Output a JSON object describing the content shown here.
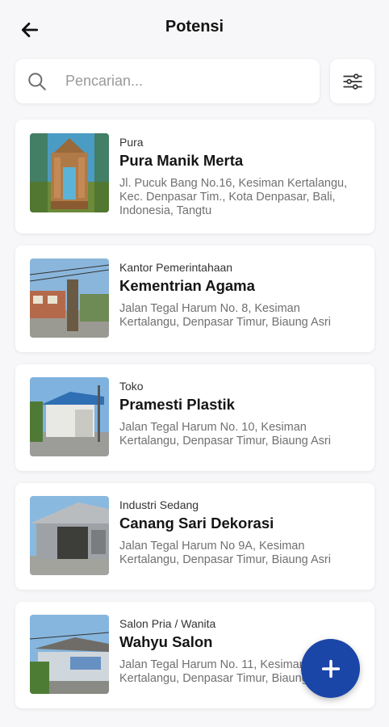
{
  "header": {
    "title": "Potensi",
    "back_icon": "arrow-left-icon"
  },
  "search": {
    "placeholder": "Pencarian...",
    "value": "",
    "icon": "search-icon"
  },
  "filter": {
    "icon": "sliders-icon"
  },
  "items": [
    {
      "category": "Pura",
      "name": "Pura Manik Merta",
      "address": "Jl. Pucuk Bang No.16, Kesiman Kertalangu, Kec. Denpasar Tim., Kota Denpasar, Bali, Indonesia, Tangtu"
    },
    {
      "category": "Kantor Pemerintahaan",
      "name": "Kementrian Agama",
      "address": "Jalan Tegal Harum No. 8, Kesiman Kertalangu, Denpasar Timur, Biaung Asri"
    },
    {
      "category": "Toko",
      "name": "Pramesti Plastik",
      "address": "Jalan Tegal Harum No. 10, Kesiman Kertalangu, Denpasar Timur, Biaung Asri"
    },
    {
      "category": "Industri Sedang",
      "name": "Canang Sari Dekorasi",
      "address": "Jalan Tegal Harum No 9A, Kesiman Kertalangu, Denpasar Timur, Biaung Asri"
    },
    {
      "category": "Salon Pria / Wanita",
      "name": "Wahyu Salon",
      "address": "Jalan Tegal Harum No. 11, Kesiman Kertalangu, Denpasar Timur, Biaung Asri"
    }
  ],
  "fab": {
    "icon": "plus-icon"
  },
  "colors": {
    "accent": "#1a46a8",
    "background": "#f7f7f9"
  }
}
